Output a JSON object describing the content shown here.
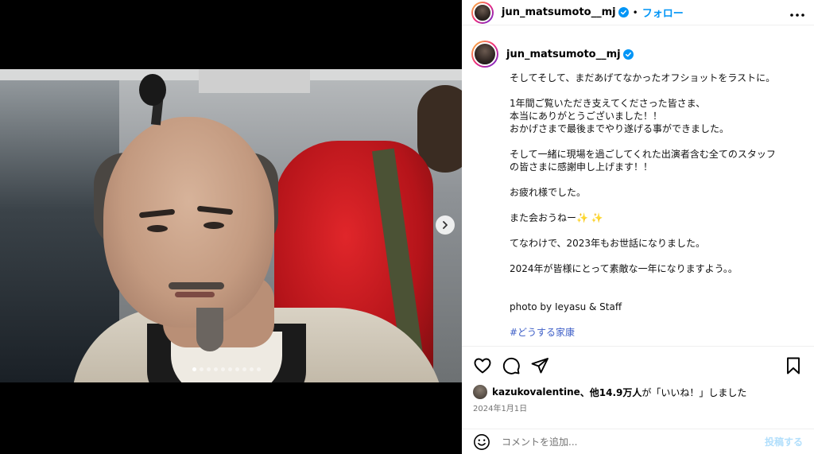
{
  "header": {
    "username": "jun_matsumoto__mj",
    "separator": "•",
    "follow_label": "フォロー",
    "more_label": "•••"
  },
  "caption": {
    "username": "jun_matsumoto__mj",
    "lines": [
      "そしてそして、まだあげてなかったオフショットをラストに。",
      "",
      "1年間ご覧いただき支えてくださった皆さま、",
      "本当にありがとうございました！！",
      "おかげさまで最後までやり遂げる事ができました。",
      "",
      "そして一緒に現場を過ごしてくれた出演者含む全てのスタッフ",
      "の皆さまに感謝申し上げます！！",
      "",
      "お疲れ様でした。",
      "",
      "また会おうねー✨ ✨",
      "",
      "てなわけで、2023年もお世話になりました。",
      "",
      "2024年が皆様にとって素敵な一年になりますよう。。",
      "",
      "",
      "photo by Ieyasu & Staff",
      ""
    ],
    "hashtag": "#どうする家康"
  },
  "media": {
    "slide_count": 10,
    "active_index": 0
  },
  "likes": {
    "liker": "kazukovalentine",
    "text_middle": "、他",
    "count": "14.9万人",
    "text_end": "が「いいね！」しました"
  },
  "date": "2024年1月1日",
  "comment": {
    "placeholder": "コメントを追加...",
    "post_label": "投稿する"
  },
  "colors": {
    "accent": "#0095f6",
    "verified": "#0095f6",
    "hashtag": "#3d5ec7",
    "muted": "#737373"
  }
}
